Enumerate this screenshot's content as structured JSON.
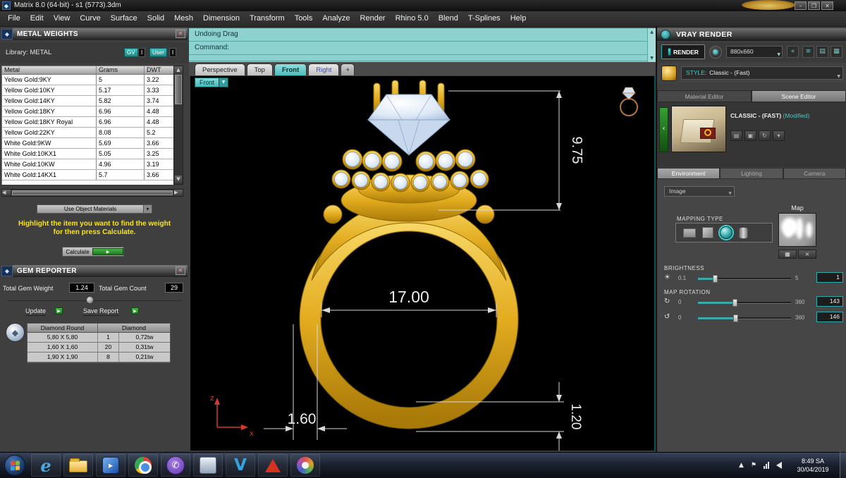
{
  "window": {
    "title": "Matrix 8.0 (64-bit) - s1 (5773).3dm",
    "controls": [
      "–",
      "❐",
      "✕"
    ],
    "menu_items": [
      "File",
      "Edit",
      "View",
      "Curve",
      "Surface",
      "Solid",
      "Mesh",
      "Dimension",
      "Transform",
      "Tools",
      "Analyze",
      "Render",
      "Rhino 5.0",
      "Blend",
      "T-Splines",
      "Help"
    ]
  },
  "metal_weights": {
    "title": "METAL WEIGHTS",
    "close": "✕",
    "library_label": "Library:  METAL",
    "gv_button": "GV",
    "user_button": "User",
    "info_badge": "I",
    "columns": [
      "Metal",
      "Grams",
      "DWT"
    ],
    "rows": [
      {
        "metal": "Yellow Gold:9KY",
        "grams": "5",
        "dwt": "3.22"
      },
      {
        "metal": "Yellow Gold:10KY",
        "grams": "5.17",
        "dwt": "3.33"
      },
      {
        "metal": "Yellow Gold:14KY",
        "grams": "5.82",
        "dwt": "3.74"
      },
      {
        "metal": "Yellow Gold:18KY",
        "grams": "6.96",
        "dwt": "4.48"
      },
      {
        "metal": "Yellow Gold:18KY Royal",
        "grams": "6.96",
        "dwt": "4.48"
      },
      {
        "metal": "Yellow Gold:22KY",
        "grams": "8.08",
        "dwt": "5.2"
      },
      {
        "metal": "White Gold:9KW",
        "grams": "5.69",
        "dwt": "3.66"
      },
      {
        "metal": "White Gold:10KX1",
        "grams": "5.05",
        "dwt": "3.25"
      },
      {
        "metal": "White Gold:10KW",
        "grams": "4.96",
        "dwt": "3.19"
      },
      {
        "metal": "White Gold:14KX1",
        "grams": "5.7",
        "dwt": "3.66"
      }
    ],
    "use_materials_label": "Use Object Materials",
    "hint_line1": "Highlight the item you want to find the weight",
    "hint_line2": "for then press Calculate.",
    "calculate_label": "Calculate"
  },
  "gem_reporter": {
    "title": "GEM REPORTER",
    "close": "✕",
    "total_weight_label": "Total Gem Weight",
    "total_weight": "1.24",
    "total_count_label": "Total Gem Count",
    "total_count": "29",
    "update_label": "Update",
    "save_label": "Save Report",
    "table_headers": [
      "Diamond Round",
      "Diamond"
    ],
    "rows": [
      {
        "size": "5,80 X 5,80",
        "count": "1",
        "weight": "0,72tw"
      },
      {
        "size": "1,60 X 1,60",
        "count": "20",
        "weight": "0,31tw"
      },
      {
        "size": "1,90 X 1,90",
        "count": "8",
        "weight": "0,21tw"
      }
    ]
  },
  "command": {
    "history_line": "Undoing Drag",
    "prompt_line": "Command:"
  },
  "viewport": {
    "tabs": [
      "Perspective",
      "Top",
      "Front",
      "Right"
    ],
    "active_tab": "Front",
    "add_tab": "+",
    "view_menu_label": "Front",
    "dim_height": "9.75",
    "dim_width": "17.00",
    "dim_shank_width": "1.60",
    "dim_shank_thickness": "1.20",
    "axis_z": "z",
    "axis_x": "x"
  },
  "vray": {
    "title": "VRAY RENDER",
    "render_label": "RENDER",
    "resolution": "880x660",
    "style_label": "STYLE:",
    "style_value": "Classic - (Fast)",
    "tabs": [
      "Material Editor",
      "Scene Editor"
    ],
    "tabs_active": "Scene Editor",
    "preset_name": "CLASSIC - (FAST)",
    "preset_modified": "(Modified)",
    "sub_tabs": [
      "Environment",
      "Lighting",
      "Camera"
    ],
    "sub_tabs_active": "Environment",
    "image_select_label": "Image",
    "mapping_type_label": "MAPPING TYPE",
    "mapping_options": [
      "plane",
      "cube",
      "sphere",
      "cylinder"
    ],
    "mapping_selected": "sphere",
    "map_label": "Map",
    "brightness": {
      "label": "BRIGHTNESS",
      "min": "0.1",
      "max": "5",
      "value": "1"
    },
    "map_rotation": {
      "label": "MAP ROTATION",
      "rows": [
        {
          "min": "0",
          "max": "360",
          "value": "143"
        },
        {
          "min": "0",
          "max": "360",
          "value": "146"
        }
      ]
    }
  },
  "taskbar": {
    "icons": [
      "internet-explorer",
      "file-explorer",
      "media-player",
      "chrome",
      "viber",
      "photos",
      "vray",
      "matrix-app",
      "paint"
    ],
    "time": "8:49 SA",
    "date": "30/04/2019"
  }
}
